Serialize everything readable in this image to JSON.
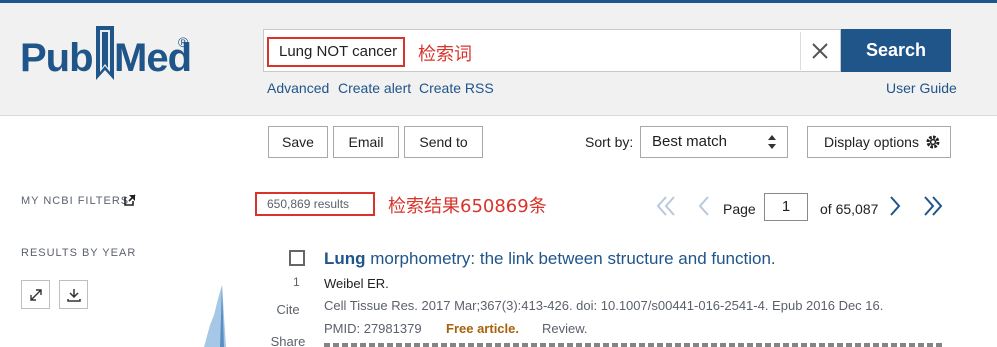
{
  "logo": {
    "text_left": "Pub",
    "text_right": "Med",
    "registered": "®"
  },
  "search": {
    "query": "Lung NOT cancer",
    "annotation": "检索词",
    "button_label": "Search",
    "links": [
      "Advanced",
      "Create alert",
      "Create RSS"
    ],
    "user_guide": "User Guide"
  },
  "toolbar": {
    "save_label": "Save",
    "email_label": "Email",
    "send_to_label": "Send to",
    "sort_label": "Sort by:",
    "sort_value": "Best match",
    "display_options_label": "Display options"
  },
  "sidebar": {
    "filters_heading": "MY NCBI FILTERS",
    "results_by_year_heading": "RESULTS BY YEAR",
    "expand_icon": "expand-icon",
    "download_icon": "download-icon"
  },
  "results": {
    "count_label": "650,869 results",
    "annotation": "检索结果650869条"
  },
  "pager": {
    "page_label": "Page",
    "current_page": "1",
    "of_label": "of 65,087"
  },
  "article": {
    "number": "1",
    "cite_label": "Cite",
    "share_label": "Share",
    "title_highlight": "Lung",
    "title_rest": " morphometry: the link between structure and function.",
    "authors": "Weibel ER.",
    "citation": "Cell Tissue Res. 2017 Mar;367(3):413-426. doi: 10.1007/s00441-016-2541-4. Epub 2016 Dec 16.",
    "pmid": "PMID: 27981379",
    "free_label": "Free article.",
    "type_label": "Review."
  },
  "colors": {
    "brand": "#20558a",
    "annotation_red": "#d9342b",
    "free_article": "#a6620d"
  }
}
